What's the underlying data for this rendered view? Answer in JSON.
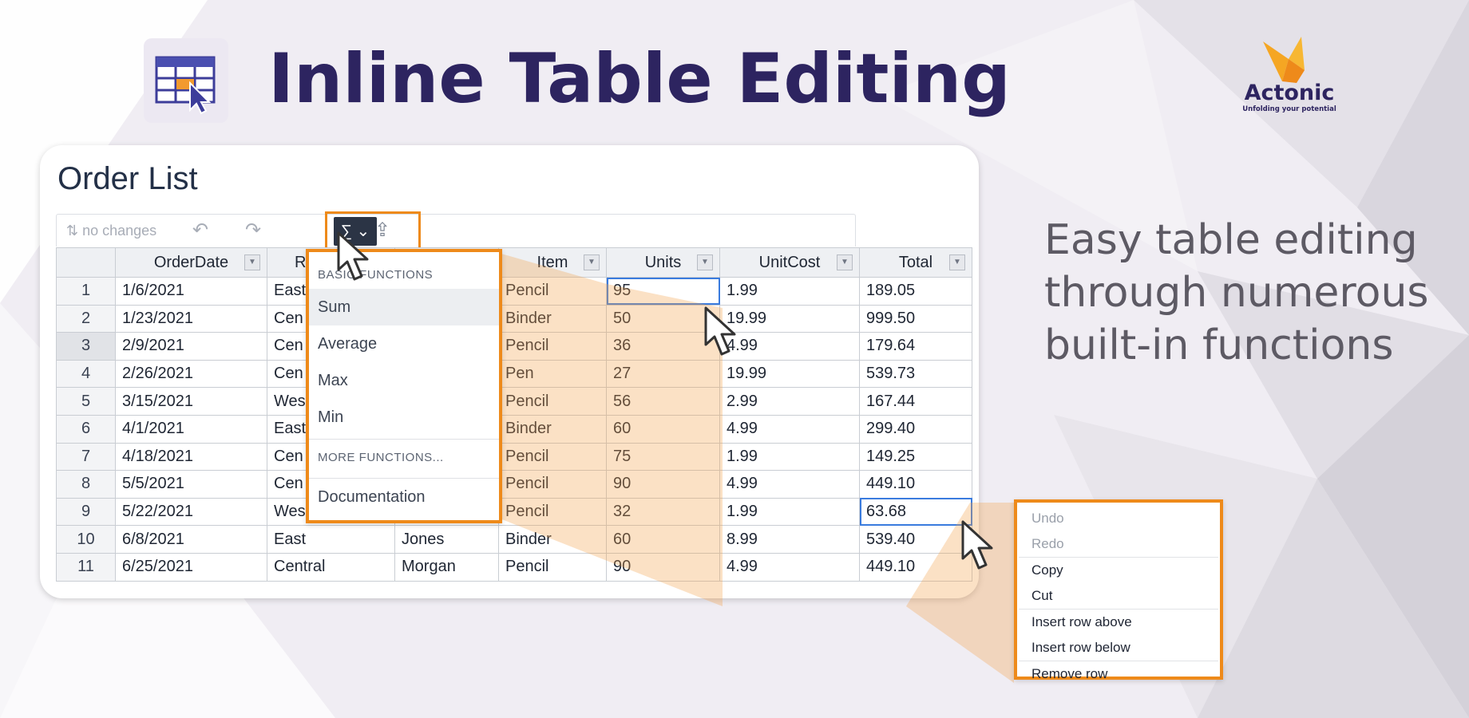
{
  "header": {
    "title": "Inline Table Editing",
    "icon": "table-edit-icon"
  },
  "brand": {
    "name": "Actonic",
    "tagline": "Unfolding your potential",
    "accent_color": "#ee8a1a"
  },
  "tagline": {
    "line1": "Easy table editing",
    "line2": "through numerous",
    "line3": "built-in functions"
  },
  "card": {
    "title": "Order List"
  },
  "toolbar": {
    "changes_status": "no changes",
    "sigma_label": "∑ ⌄"
  },
  "table": {
    "columns": [
      "OrderDate",
      "R",
      "",
      "Item",
      "Units",
      "UnitCost",
      "Total"
    ],
    "rows": [
      {
        "n": "1",
        "date": "1/6/2021",
        "region": "East",
        "rep": "",
        "item": "Pencil",
        "units": "95",
        "cost": "1.99",
        "total": "189.05"
      },
      {
        "n": "2",
        "date": "1/23/2021",
        "region": "Cen",
        "rep": "",
        "item": "Binder",
        "units": "50",
        "cost": "19.99",
        "total": "999.50"
      },
      {
        "n": "3",
        "date": "2/9/2021",
        "region": "Cen",
        "rep": "",
        "item": "Pencil",
        "units": "36",
        "cost": "4.99",
        "total": "179.64"
      },
      {
        "n": "4",
        "date": "2/26/2021",
        "region": "Cen",
        "rep": "",
        "item": "Pen",
        "units": "27",
        "cost": "19.99",
        "total": "539.73"
      },
      {
        "n": "5",
        "date": "3/15/2021",
        "region": "Wes",
        "rep": "",
        "item": "Pencil",
        "units": "56",
        "cost": "2.99",
        "total": "167.44"
      },
      {
        "n": "6",
        "date": "4/1/2021",
        "region": "East",
        "rep": "",
        "item": "Binder",
        "units": "60",
        "cost": "4.99",
        "total": "299.40"
      },
      {
        "n": "7",
        "date": "4/18/2021",
        "region": "Cen",
        "rep": "",
        "item": "Pencil",
        "units": "75",
        "cost": "1.99",
        "total": "149.25"
      },
      {
        "n": "8",
        "date": "5/5/2021",
        "region": "Cen",
        "rep": "",
        "item": "Pencil",
        "units": "90",
        "cost": "4.99",
        "total": "449.10"
      },
      {
        "n": "9",
        "date": "5/22/2021",
        "region": "Wes",
        "rep": "",
        "item": "Pencil",
        "units": "32",
        "cost": "1.99",
        "total": "63.68"
      },
      {
        "n": "10",
        "date": "6/8/2021",
        "region": "East",
        "rep": "Jones",
        "item": "Binder",
        "units": "60",
        "cost": "8.99",
        "total": "539.40"
      },
      {
        "n": "11",
        "date": "6/25/2021",
        "region": "Central",
        "rep": "Morgan",
        "item": "Pencil",
        "units": "90",
        "cost": "4.99",
        "total": "449.10"
      }
    ]
  },
  "functions_menu": {
    "basic_header": "BASIC FUNCTIONS",
    "items": [
      "Sum",
      "Average",
      "Max",
      "Min"
    ],
    "more_header": "MORE FUNCTIONS...",
    "documentation": "Documentation"
  },
  "context_menu": {
    "items": [
      "Undo",
      "Redo",
      "Copy",
      "Cut",
      "Insert row above",
      "Insert row below",
      "Remove row"
    ]
  }
}
